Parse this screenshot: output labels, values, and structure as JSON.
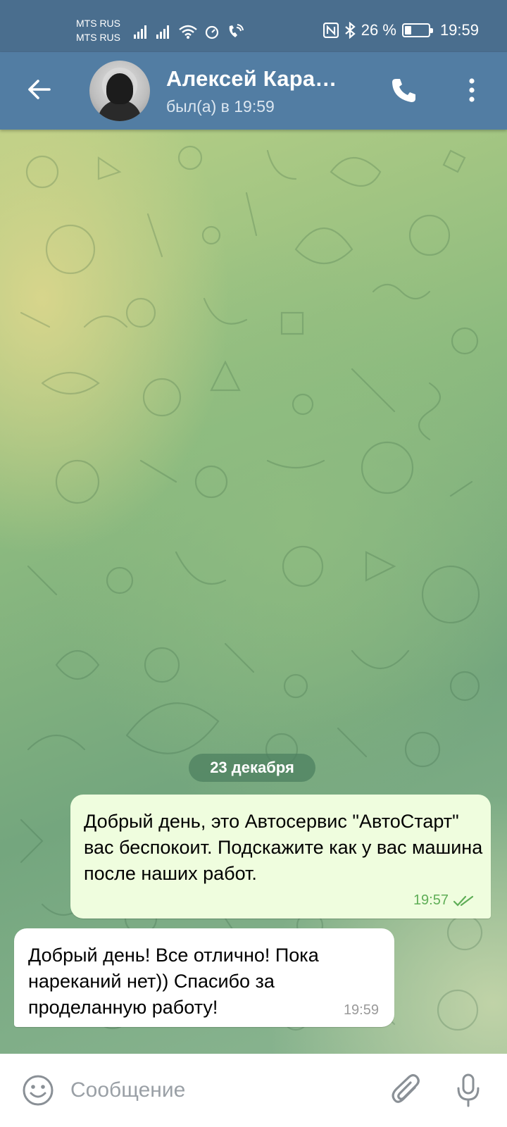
{
  "status_bar": {
    "carrier_1": "MTS RUS",
    "carrier_2": "MTS RUS",
    "battery_percent": "26 %",
    "battery_level": 0.26,
    "time": "19:59",
    "icons": [
      "signal-icon",
      "signal-icon",
      "wifi-icon",
      "alarm-icon",
      "wifi-call-icon",
      "nfc-icon",
      "bluetooth-icon",
      "battery-icon"
    ]
  },
  "header": {
    "contact_name": "Алексей Кара…",
    "contact_status": "был(а) в 19:59",
    "icons": [
      "back-arrow-icon",
      "avatar",
      "phone-icon",
      "more-vertical-icon"
    ]
  },
  "chat": {
    "date_separator": "23 декабря",
    "messages": [
      {
        "direction": "outgoing",
        "text": "Добрый день, это Автосервис \"АвтоСтарт\" вас беспокоит. Подскажите как у вас машина после наших работ.",
        "time": "19:57",
        "status_icon": "double-check-icon"
      },
      {
        "direction": "incoming",
        "text": "Добрый день! Все отлично! Пока нареканий нет)) Спасибо за проделанную работу!",
        "time": "19:59"
      }
    ]
  },
  "composer": {
    "placeholder": "Сообщение",
    "icons": [
      "emoji-icon",
      "paperclip-icon",
      "microphone-icon"
    ]
  },
  "colors": {
    "status_bar_bg": "#4a6e8e",
    "header_bg": "#527da3",
    "outgoing_bubble": "#effdde",
    "incoming_bubble": "#ffffff",
    "read_check": "#5fae57",
    "date_pill_bg": "#4e8060"
  }
}
